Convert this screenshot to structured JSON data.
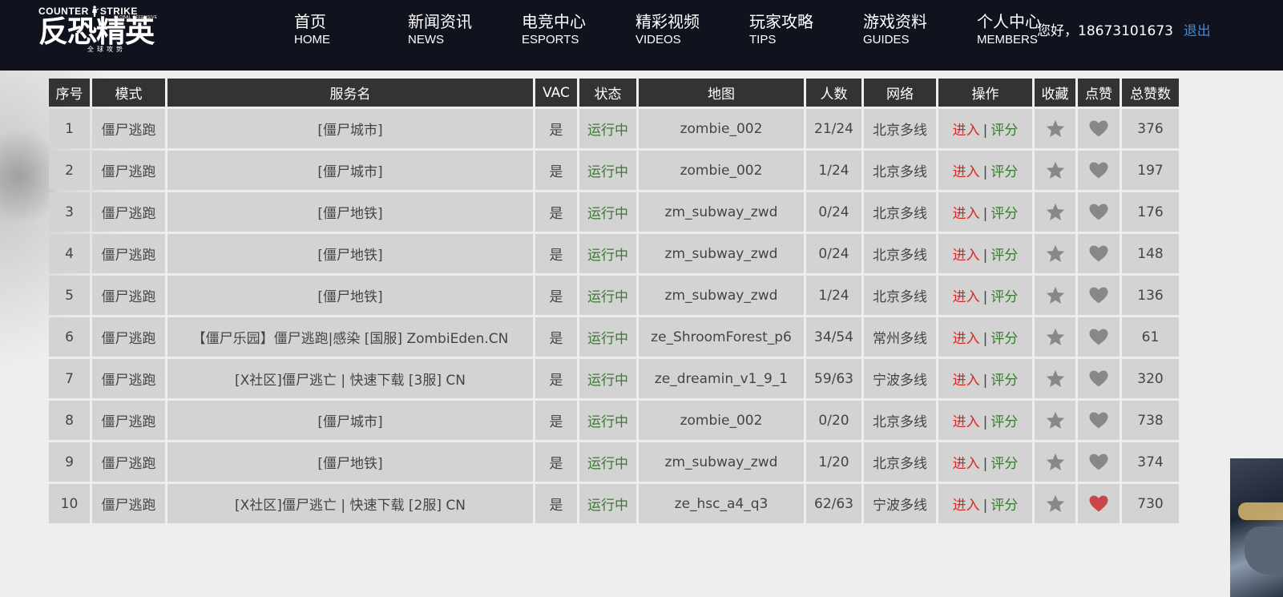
{
  "header": {
    "logo": {
      "top_left": "COUNTER",
      "top_right": "STRIKE",
      "top_sub": "GLOBAL OFFENSIVE",
      "main": "反恐精英",
      "small": "全球攻势"
    },
    "nav": [
      {
        "cn": "首页",
        "en": "HOME"
      },
      {
        "cn": "新闻资讯",
        "en": "NEWS"
      },
      {
        "cn": "电竞中心",
        "en": "ESPORTS"
      },
      {
        "cn": "精彩视频",
        "en": "VIDEOS"
      },
      {
        "cn": "玩家攻略",
        "en": "TIPS"
      },
      {
        "cn": "游戏资料",
        "en": "GUIDES"
      },
      {
        "cn": "个人中心",
        "en": "MEMBERS"
      }
    ],
    "greeting": "您好，18673101673",
    "logout": "退出"
  },
  "table": {
    "columns": [
      "序号",
      "模式",
      "服务名",
      "VAC",
      "状态",
      "地图",
      "人数",
      "网络",
      "操作",
      "收藏",
      "点赞",
      "总赞数"
    ],
    "action_enter": "进入",
    "action_sep": "|",
    "action_rate": "评分",
    "rows": [
      {
        "no": "1",
        "mode": "僵尸逃跑",
        "name": "[僵尸城市]",
        "vac": "是",
        "status": "运行中",
        "map": "zombie_002",
        "players": "21/24",
        "network": "北京多线",
        "liked": false,
        "likes": "376"
      },
      {
        "no": "2",
        "mode": "僵尸逃跑",
        "name": "[僵尸城市]",
        "vac": "是",
        "status": "运行中",
        "map": "zombie_002",
        "players": "1/24",
        "network": "北京多线",
        "liked": false,
        "likes": "197"
      },
      {
        "no": "3",
        "mode": "僵尸逃跑",
        "name": "[僵尸地铁]",
        "vac": "是",
        "status": "运行中",
        "map": "zm_subway_zwd",
        "players": "0/24",
        "network": "北京多线",
        "liked": false,
        "likes": "176"
      },
      {
        "no": "4",
        "mode": "僵尸逃跑",
        "name": "[僵尸地铁]",
        "vac": "是",
        "status": "运行中",
        "map": "zm_subway_zwd",
        "players": "0/24",
        "network": "北京多线",
        "liked": false,
        "likes": "148"
      },
      {
        "no": "5",
        "mode": "僵尸逃跑",
        "name": "[僵尸地铁]",
        "vac": "是",
        "status": "运行中",
        "map": "zm_subway_zwd",
        "players": "1/24",
        "network": "北京多线",
        "liked": false,
        "likes": "136"
      },
      {
        "no": "6",
        "mode": "僵尸逃跑",
        "name": "【僵尸乐园】僵尸逃跑|感染 [国服] ZombiEden.CN",
        "vac": "是",
        "status": "运行中",
        "map": "ze_ShroomForest_p6",
        "players": "34/54",
        "network": "常州多线",
        "liked": false,
        "likes": "61"
      },
      {
        "no": "7",
        "mode": "僵尸逃跑",
        "name": "[X社区]僵尸逃亡 | 快速下载 [3服] CN",
        "vac": "是",
        "status": "运行中",
        "map": "ze_dreamin_v1_9_1",
        "players": "59/63",
        "network": "宁波多线",
        "liked": false,
        "likes": "320"
      },
      {
        "no": "8",
        "mode": "僵尸逃跑",
        "name": "[僵尸城市]",
        "vac": "是",
        "status": "运行中",
        "map": "zombie_002",
        "players": "0/20",
        "network": "北京多线",
        "liked": false,
        "likes": "738"
      },
      {
        "no": "9",
        "mode": "僵尸逃跑",
        "name": "[僵尸地铁]",
        "vac": "是",
        "status": "运行中",
        "map": "zm_subway_zwd",
        "players": "1/20",
        "network": "北京多线",
        "liked": false,
        "likes": "374"
      },
      {
        "no": "10",
        "mode": "僵尸逃跑",
        "name": "[X社区]僵尸逃亡 | 快速下载 [2服] CN",
        "vac": "是",
        "status": "运行中",
        "map": "ze_hsc_a4_q3",
        "players": "62/63",
        "network": "宁波多线",
        "liked": true,
        "likes": "730"
      }
    ]
  },
  "colors": {
    "header_bg": "#10131d",
    "table_header_bg": "#333333",
    "cell_bg": "#d3d3d3",
    "status_green": "#3a7a32",
    "enter_red": "#e0211f",
    "logout_blue": "#4f86c6",
    "icon_gray": "#888888",
    "heart_liked": "#c9474b"
  }
}
